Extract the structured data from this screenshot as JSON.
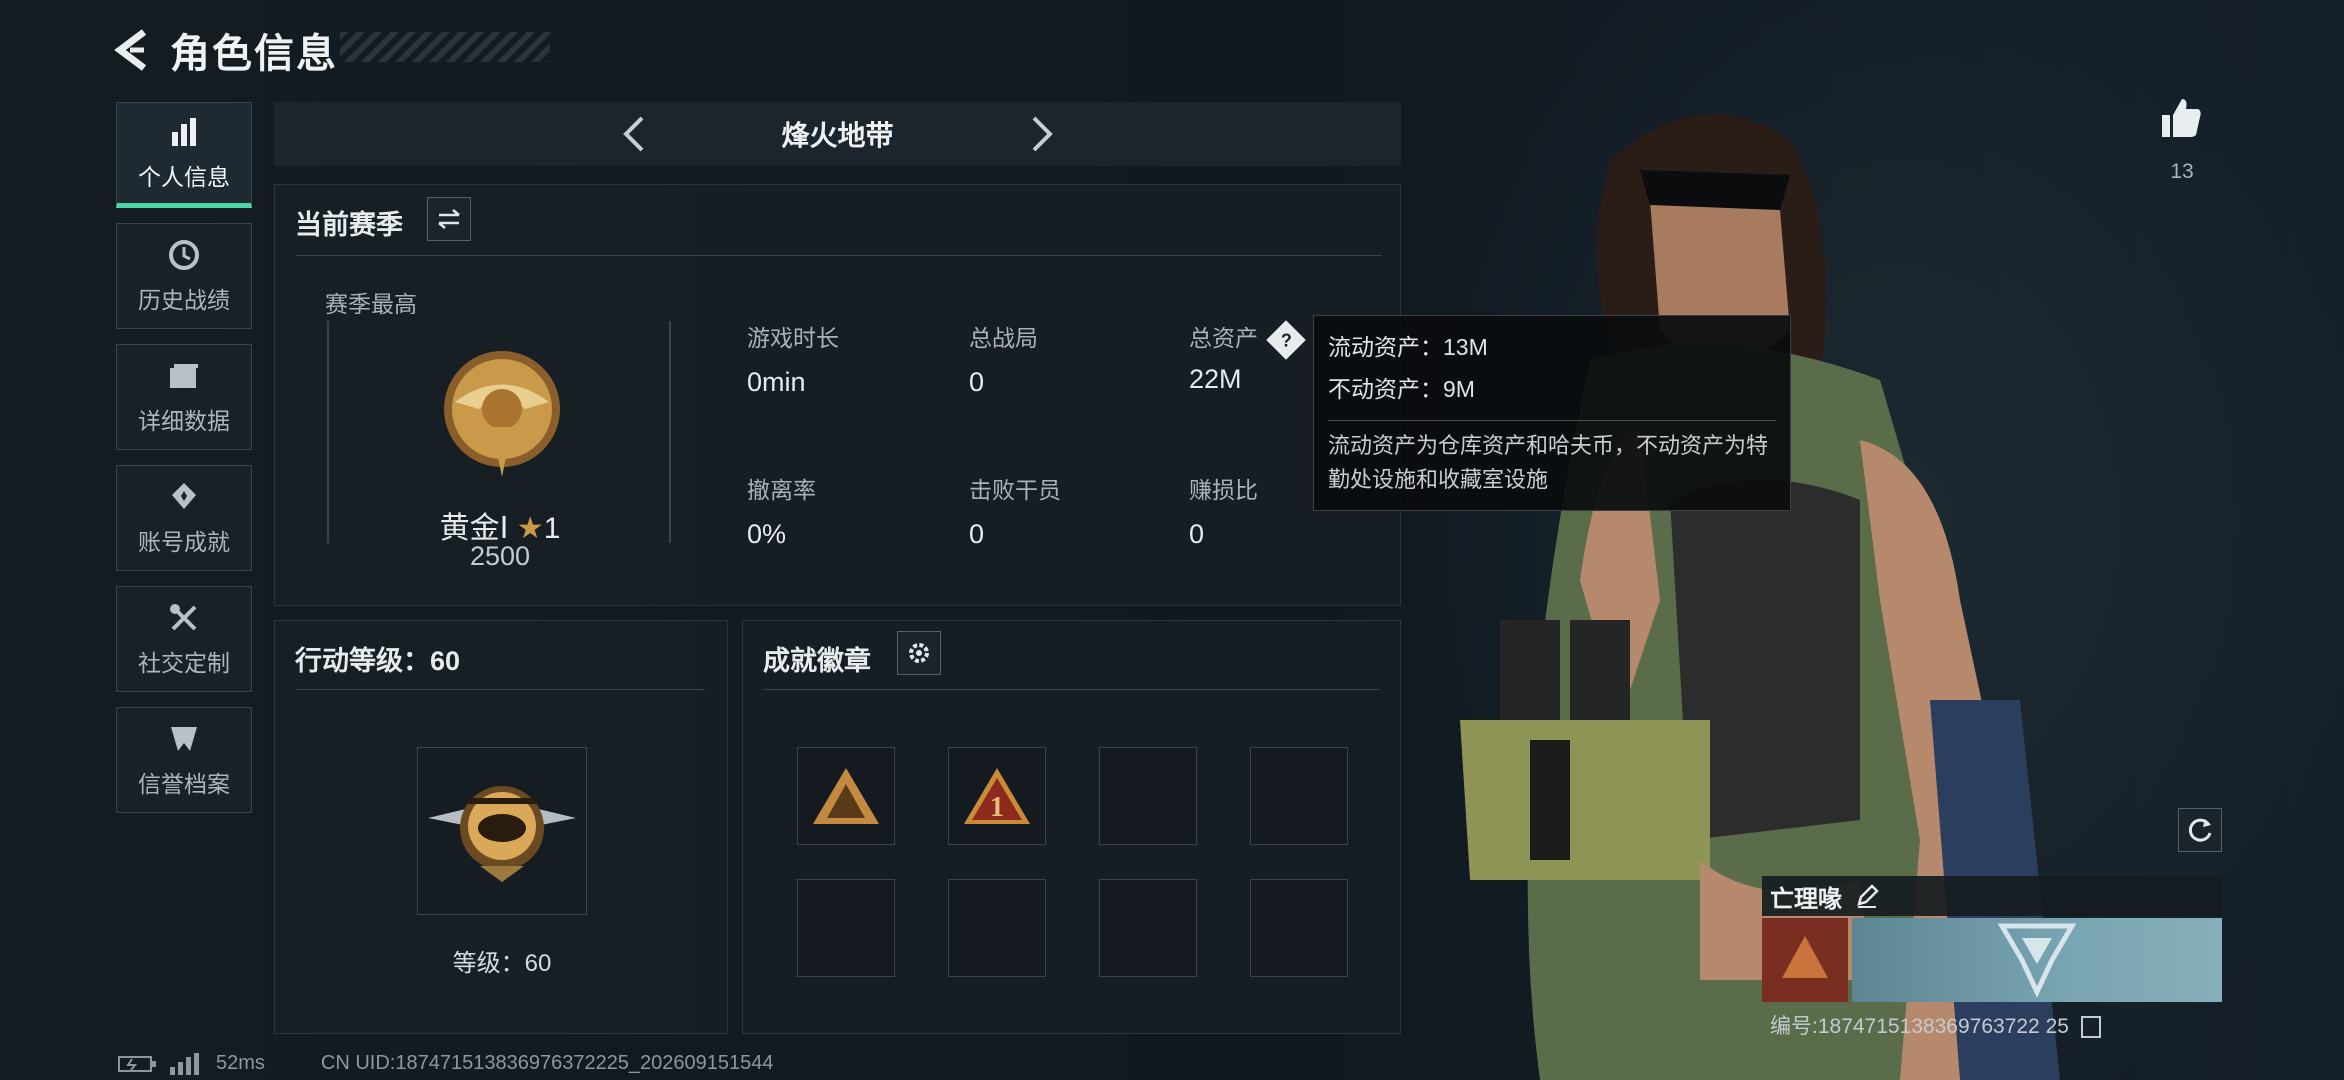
{
  "header": {
    "title": "角色信息"
  },
  "nav": {
    "items": [
      {
        "label": "个人信息",
        "icon": "bar-chart-icon"
      },
      {
        "label": "历史战绩",
        "icon": "clock-history-icon"
      },
      {
        "label": "详细数据",
        "icon": "folder-icon"
      },
      {
        "label": "账号成就",
        "icon": "medal-icon"
      },
      {
        "label": "社交定制",
        "icon": "wrench-icon"
      },
      {
        "label": "信誉档案",
        "icon": "shield-emblem-icon"
      }
    ]
  },
  "mode": {
    "name": "烽火地带"
  },
  "season": {
    "title": "当前赛季",
    "best_label": "赛季最高",
    "rank_name": "黄金Ⅰ",
    "rank_stars": "1",
    "rank_score": "2500",
    "stats": [
      {
        "label": "游戏时长",
        "value": "0min"
      },
      {
        "label": "总战局",
        "value": "0"
      },
      {
        "label": "总资产",
        "value": "22M"
      },
      {
        "label": "撤离率",
        "value": "0%"
      },
      {
        "label": "击败干员",
        "value": "0"
      },
      {
        "label": "赚损比",
        "value": "0"
      }
    ]
  },
  "tooltip": {
    "liquid": "流动资产：13M",
    "fixed": "不动资产：9M",
    "desc": "流动资产为仓库资产和哈夫币，不动资产为特勤处设施和收藏室设施"
  },
  "action": {
    "title": "行动等级：60",
    "level_text": "等级：60"
  },
  "badges": {
    "title": "成就徽章"
  },
  "profile": {
    "like_count": "13",
    "name": "亡理喙",
    "id_text": "编号:1874715138369763722 25"
  },
  "footer": {
    "ping": "52ms",
    "uid": "CN UID:187471513836976372225_202609151544"
  },
  "colors": {
    "accent": "#4ad6a8",
    "panel": "#181f25",
    "gold": "#c99a4a"
  }
}
